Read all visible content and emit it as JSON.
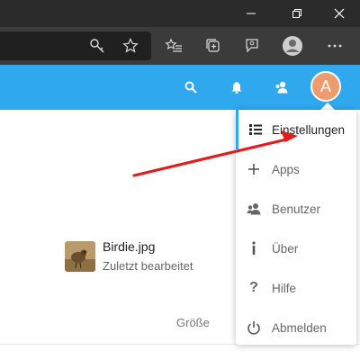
{
  "browser": {
    "icons": [
      "minimize-icon",
      "restore-icon",
      "close-icon",
      "key-icon",
      "star-icon",
      "favorites-icon",
      "collections-icon",
      "feedback-icon",
      "profile-icon",
      "more-icon"
    ]
  },
  "header": {
    "avatar_letter": "A",
    "icons": [
      "search-icon",
      "bell-icon",
      "contacts-icon"
    ],
    "color": "#2fa8ee",
    "avatar_color": "#ee9b6f"
  },
  "file": {
    "name": "Birdie.jpg",
    "subtitle": "Zuletzt bearbeitet"
  },
  "table": {
    "size_header": "Größe"
  },
  "menu": {
    "items": [
      {
        "label": "Einstellungen",
        "icon": "list-icon"
      },
      {
        "label": "Apps",
        "icon": "plus-icon"
      },
      {
        "label": "Benutzer",
        "icon": "users-icon"
      },
      {
        "label": "Über",
        "icon": "info-icon"
      },
      {
        "label": "Hilfe",
        "icon": "question-icon"
      },
      {
        "label": "Abmelden",
        "icon": "power-icon"
      }
    ]
  },
  "annotation": {
    "arrow_color": "#e21b1b"
  }
}
